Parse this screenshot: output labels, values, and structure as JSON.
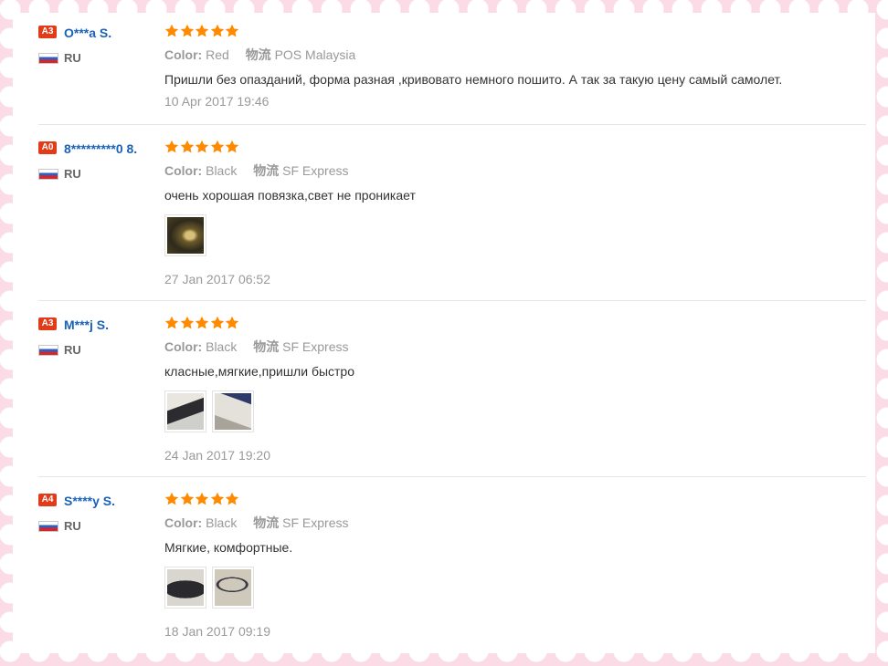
{
  "reviews": [
    {
      "level": "A3",
      "user": "O***a S.",
      "country": "RU",
      "rating": 5,
      "color_label": "Color:",
      "color_value": "Red",
      "shipping_label": "物流",
      "shipping_value": "POS Malaysia",
      "text": "Пришли без опазданий, форма разная ,кривовато немного пошито. А так за такую цену самый самолет.",
      "date": "10 Apr 2017 19:46",
      "photos": []
    },
    {
      "level": "A0",
      "user": "8*********0 8.",
      "country": "RU",
      "rating": 5,
      "color_label": "Color:",
      "color_value": "Black",
      "shipping_label": "物流",
      "shipping_value": "SF Express",
      "text": "очень хорошая повязка,свет не проникает",
      "date": "27 Jan 2017 06:52",
      "photos": [
        "review-photo"
      ]
    },
    {
      "level": "A3",
      "user": "M***j S.",
      "country": "RU",
      "rating": 5,
      "color_label": "Color:",
      "color_value": "Black",
      "shipping_label": "物流",
      "shipping_value": "SF Express",
      "text": "класные,мягкие,пришли быстро",
      "date": "24 Jan 2017 19:20",
      "photos": [
        "review-photo",
        "review-photo"
      ]
    },
    {
      "level": "A4",
      "user": "S****y S.",
      "country": "RU",
      "rating": 5,
      "color_label": "Color:",
      "color_value": "Black",
      "shipping_label": "物流",
      "shipping_value": "SF Express",
      "text": "Мягкие, комфортные.",
      "date": "18 Jan 2017 09:19",
      "photos": [
        "review-photo",
        "review-photo"
      ]
    }
  ],
  "colors": {
    "level_badge": "#e23b1a",
    "username": "#1a62b8",
    "star": "#ff8a00",
    "border_pink": "#fadbe6"
  }
}
